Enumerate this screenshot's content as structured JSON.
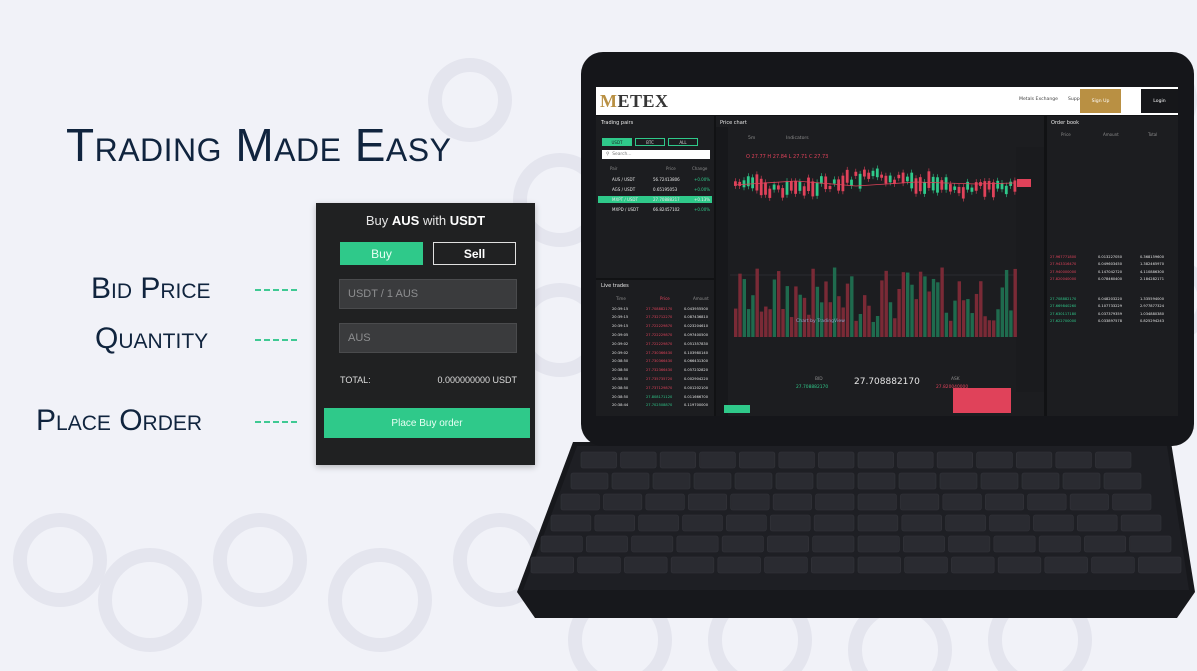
{
  "headline": "Trading Made Easy",
  "callouts": {
    "bid_price": "Bid Price",
    "quantity": "Quantity",
    "place_order": "Place Order"
  },
  "order_ticket": {
    "title_prefix": "Buy ",
    "title_asset": "AUS",
    "title_mid": " with ",
    "title_quote": "USDT",
    "buy_tab": "Buy",
    "sell_tab": "Sell",
    "price_placeholder": "USDT / 1 AUS",
    "quantity_placeholder": "AUS",
    "total_label": "TOTAL:",
    "total_value": "0.000000000 USDT",
    "place_button": "Place Buy order"
  },
  "exchange": {
    "logo_first": "M",
    "logo_rest": "ETEX",
    "nav": {
      "metals": "Metals Exchange",
      "support": "Support",
      "signup": "Sign Up",
      "login": "Login"
    },
    "trading_pairs": {
      "title": "Trading pairs",
      "tabs": [
        "USDT",
        "BTC",
        "ALL"
      ],
      "search_placeholder": "Search...",
      "columns": [
        "Pair",
        "Price",
        "Change"
      ],
      "rows": [
        {
          "pair": "AUS / USDT",
          "price": "56.72413806",
          "change": "+0.00%"
        },
        {
          "pair": "AGS / USDT",
          "price": "0.65195053",
          "change": "+0.00%"
        },
        {
          "pair": "MXPT / USDT",
          "price": "27.70888217",
          "change": "+0.13%"
        },
        {
          "pair": "MXPD / USDT",
          "price": "66.82457102",
          "change": "+0.00%"
        }
      ]
    },
    "live_trades": {
      "title": "Live trades",
      "columns": [
        "Time",
        "Price",
        "Amount"
      ],
      "rows": [
        [
          "20:39:15",
          "27.708882170",
          "0.043955500"
        ],
        [
          "20:39:15",
          "27.732712270",
          "0.087436810"
        ],
        [
          "20:39:15",
          "27.722229870",
          "0.023204610"
        ],
        [
          "20:39:05",
          "27.722229870",
          "0.097400500"
        ],
        [
          "20:39:02",
          "27.722229870",
          "0.051357830"
        ],
        [
          "20:39:02",
          "27.730366430",
          "0.103980140"
        ],
        [
          "20:38:50",
          "27.730366430",
          "0.066431300"
        ],
        [
          "20:38:50",
          "27.732366430",
          "0.057232820"
        ],
        [
          "20:38:50",
          "27.735735720",
          "0.002904220"
        ],
        [
          "20:38:50",
          "27.737129870",
          "0.001202100"
        ],
        [
          "20:38:50",
          "27.808171120",
          "0.011666700"
        ],
        [
          "20:38:44",
          "27.702508870",
          "0.119700000"
        ]
      ]
    },
    "price_chart": {
      "title": "Price chart",
      "toolbar": {
        "interval": "5m",
        "indicators": "Indicators"
      },
      "ohlc": "O 27.77  H 27.84  L 27.71  C 27.73",
      "watermark": "Chart by TradingView",
      "bid_label": "BID",
      "ask_label": "ASK",
      "bid_value": "27.708882170",
      "last_price": "27.708882170",
      "ask_value": "27.820040000"
    },
    "order_book": {
      "title": "Order book",
      "columns": [
        "Price",
        "Amount",
        "Total"
      ],
      "asks": [
        [
          "27.967771800",
          "0.013227050",
          "0.368159600"
        ],
        [
          "27.943316470",
          "0.049603450",
          "1.382465970"
        ],
        [
          "27.940000000",
          "0.147042720",
          "4.110886300"
        ],
        [
          "27.820040000",
          "0.078460400",
          "2.184282171"
        ]
      ],
      "bids": [
        [
          "27.708882170",
          "0.048203220",
          "1.335594000"
        ],
        [
          "27.669840260",
          "0.107733229",
          "2.977877324"
        ],
        [
          "27.630117180",
          "0.037379359",
          "1.034880380"
        ],
        [
          "27.622700000",
          "0.033897578",
          "0.825294243"
        ]
      ]
    }
  },
  "colors": {
    "accent_green": "#2fc98a",
    "down_red": "#e0425a",
    "gold": "#b99043",
    "navy_text": "#10243e"
  }
}
